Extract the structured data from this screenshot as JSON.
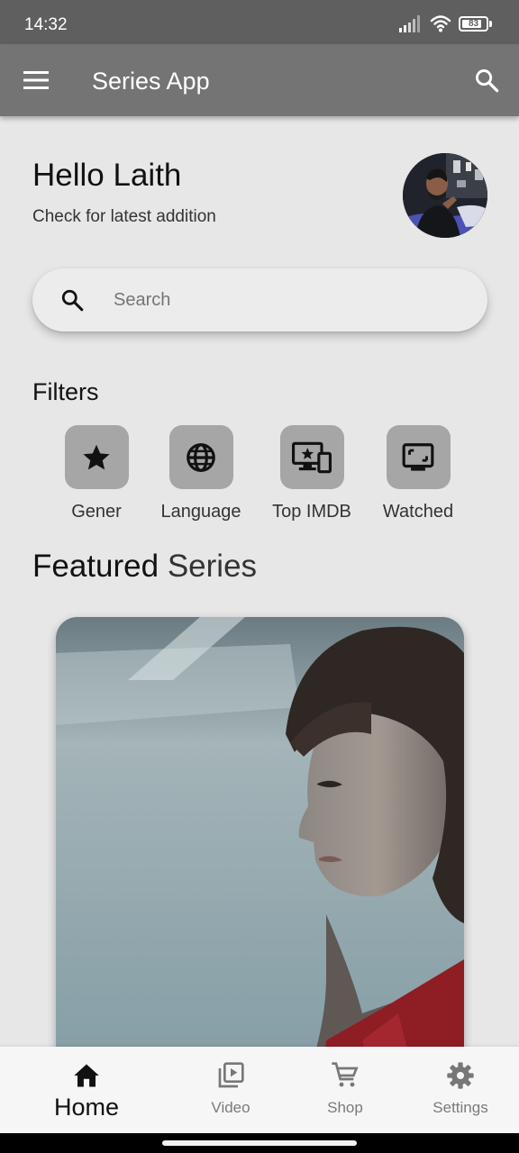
{
  "status_bar": {
    "time": "14:32",
    "battery_level": "83"
  },
  "app_bar": {
    "title": "Series App"
  },
  "greeting": {
    "title": "Hello Laith",
    "subtitle": "Check for latest addition"
  },
  "search": {
    "placeholder": "Search",
    "value": ""
  },
  "filters": {
    "title": "Filters",
    "items": [
      {
        "label": "Gener",
        "icon": "star-icon"
      },
      {
        "label": "Language",
        "icon": "globe-icon"
      },
      {
        "label": "Top IMDB",
        "icon": "devices-star-icon"
      },
      {
        "label": "Watched",
        "icon": "tv-icon"
      }
    ]
  },
  "featured": {
    "title_bold": "Featured",
    "title_light": "Series"
  },
  "bottom_nav": {
    "items": [
      {
        "label": "Home",
        "icon": "home-icon",
        "active": true
      },
      {
        "label": "Video",
        "icon": "video-library-icon",
        "active": false
      },
      {
        "label": "Shop",
        "icon": "cart-icon",
        "active": false
      },
      {
        "label": "Settings",
        "icon": "gear-icon",
        "active": false
      }
    ]
  },
  "colors": {
    "background": "#e7e7e7",
    "status_bar": "#5f5f5f",
    "app_bar": "#747474",
    "filter_tile": "#a6a6a6",
    "nav_background": "#f6f6f6"
  }
}
